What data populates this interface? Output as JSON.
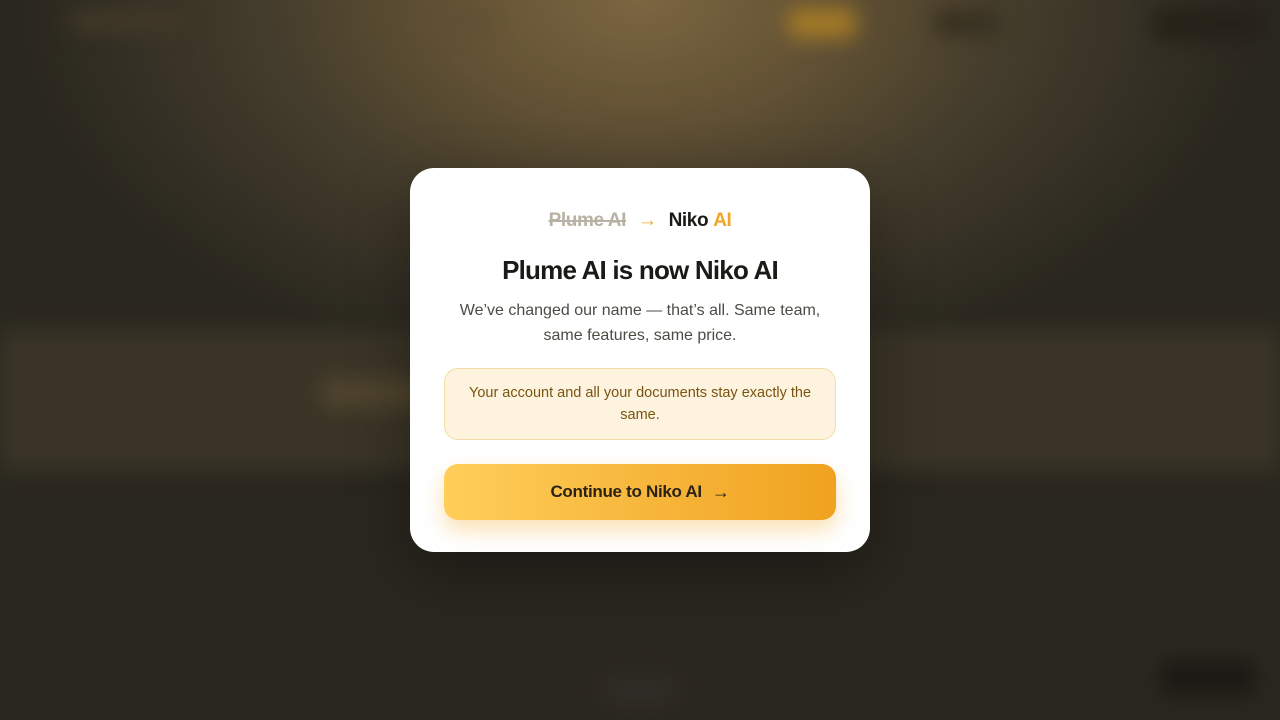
{
  "rename": {
    "old_name": "Plume AI",
    "arrow": "→",
    "new_name_part1": "Niko",
    "new_name_part2": "AI"
  },
  "modal": {
    "title": "Plume AI is now Niko AI",
    "subtitle": "We’ve changed our name — that’s all. Same team, same features, same price.",
    "notice": "Your account and all your documents stay exactly the same.",
    "cta_label": "Continue to Niko AI",
    "cta_arrow": "→"
  },
  "colors": {
    "accent": "#f0a623",
    "notice_bg": "#fdf3de",
    "notice_text": "#7a5412",
    "title": "#1b1a17"
  }
}
